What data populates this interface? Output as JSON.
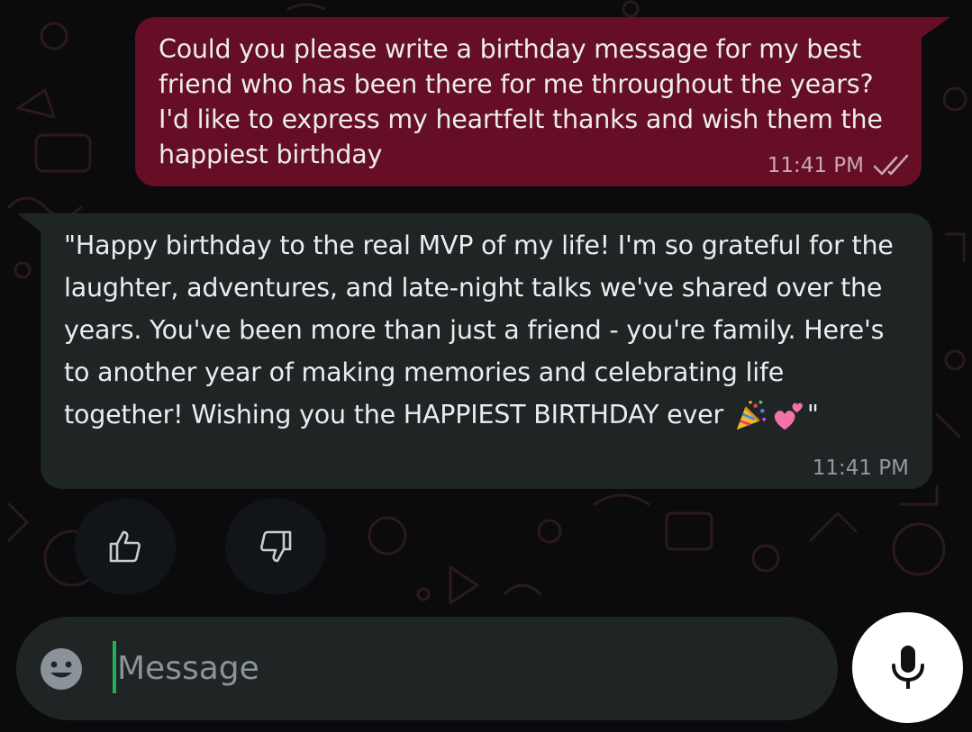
{
  "theme": {
    "background": "#0b0a0d",
    "outgoing_bubble": "#650e26",
    "incoming_bubble": "#1f2425",
    "composer_background": "#1f2425",
    "caret_color": "#1fb356",
    "mic_button": "#ffffff"
  },
  "conversation": {
    "outgoing": {
      "text": "Could you please write a birthday message for my best friend who has been there for me throughout the years? I'd like to express my heartfelt thanks and wish them the happiest birthday",
      "time": "11:41 PM",
      "status_icon": "double-check-icon"
    },
    "incoming": {
      "text": "\"Happy birthday to the real MVP of my life! I'm so grateful for the laughter, adventures, and late-night talks we've shared over the years. You've been more than just a friend - you're family. Here's to another year of making memories and celebrating life together! Wishing you the HAPPIEST BIRTHDAY ever",
      "emojis": [
        "party-popper-emoji",
        "two-hearts-emoji"
      ],
      "text_end": "\"",
      "time": "11:41 PM"
    }
  },
  "feedback": {
    "like_icon": "thumbs-up-icon",
    "dislike_icon": "thumbs-down-icon"
  },
  "composer": {
    "placeholder": "Message",
    "value": "",
    "emoji_icon": "smiley-icon",
    "mic_icon": "microphone-icon"
  }
}
